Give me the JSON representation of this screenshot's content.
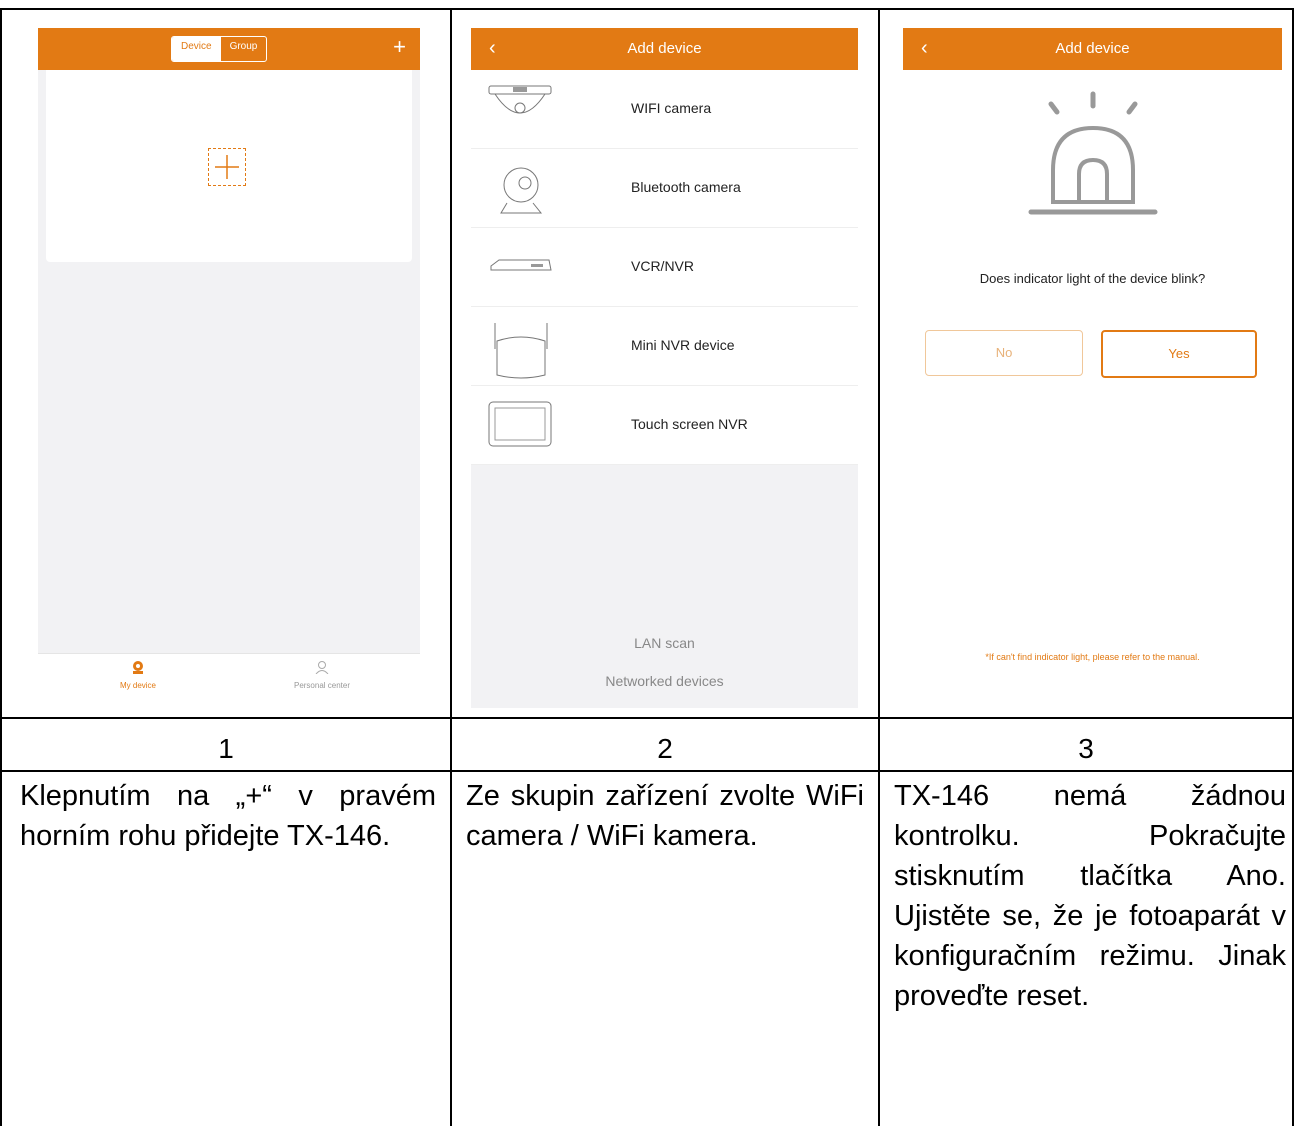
{
  "panel1": {
    "tab_device": "Device",
    "tab_group": "Group",
    "top_plus": "+",
    "nav_my_device": "My device",
    "nav_personal_center": "Personal center"
  },
  "panel2": {
    "title": "Add device",
    "items": [
      "WIFI camera",
      "Bluetooth camera",
      "VCR/NVR",
      "Mini NVR device",
      "Touch screen NVR"
    ],
    "lan_scan": "LAN scan",
    "networked_devices": "Networked devices"
  },
  "panel3": {
    "title": "Add device",
    "question": "Does indicator light of the device blink?",
    "no_label": "No",
    "yes_label": "Yes",
    "note": "*If can't find indicator light, please refer to the manual."
  },
  "numbers": [
    "1",
    "2",
    "3"
  ],
  "captions": {
    "c1": "Klepnutím na „+“ v pravém horním rohu přidejte TX-146.",
    "c2": "Ze skupin zařízení zvolte WiFi camera / WiFi kamera.",
    "c3": "TX-146 nemá žádnou kontrolku. Pokračujte stisknutím tlačítka Ano. Ujistěte se, že je fotoaparát v konfiguračním režimu. Jinak proveďte reset."
  },
  "colors": {
    "accent": "#e27a14",
    "list_bg": "#f2f2f4"
  }
}
